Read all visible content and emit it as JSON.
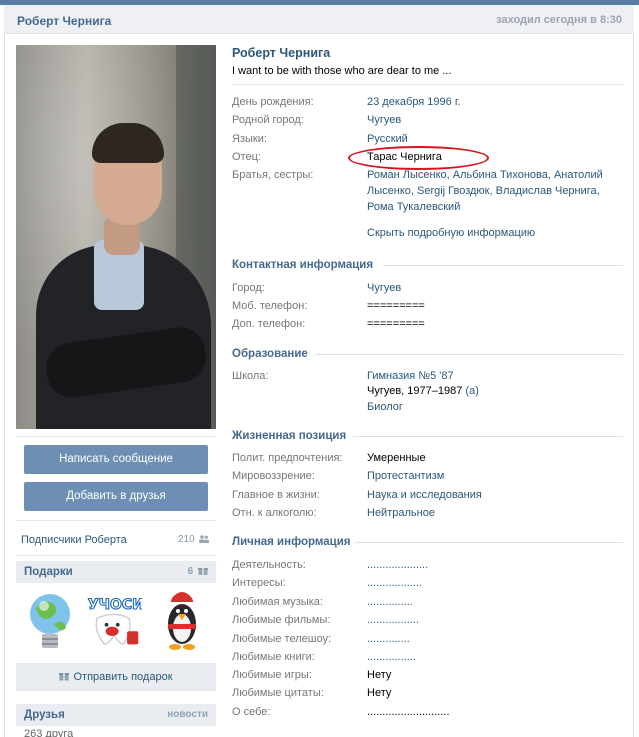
{
  "header": {
    "name": "Роберт Чернига",
    "last_seen": "заходил сегодня в 8:30"
  },
  "left": {
    "write_message": "Написать сообщение",
    "add_friend": "Добавить в друзья",
    "followers_label": "Подписчики Роберта",
    "followers_count": "210",
    "gifts_title": "Подарки",
    "gifts_count": "6",
    "send_gift": "Отправить подарок",
    "friends_title": "Друзья",
    "friends_news": "новости",
    "friends_count": "263 друга"
  },
  "profile": {
    "name": "Роберт Чернига",
    "status": "I want to be with those who are dear to me ...",
    "birthday_label": "День рождения:",
    "birthday": "23 декабря 1996 г.",
    "hometown_label": "Родной город:",
    "hometown": "Чугуев",
    "languages_label": "Языки:",
    "languages": "Русский",
    "father_label": "Отец:",
    "father": "Тарас Чернига",
    "siblings_label": "Братья, сестры:",
    "siblings": [
      "Роман Лысенко, Альбина Тихонова, Анатолий",
      "Лысенко, Sergij Гвоздюк, Владислав Чернига,",
      "Рома Тукалевский"
    ],
    "hide_details": "Скрыть подробную информацию"
  },
  "contacts": {
    "title": "Контактная информация",
    "city_label": "Город:",
    "city": "Чугуев",
    "mobile_label": "Моб. телефон:",
    "mobile": "=========",
    "phone_label": "Доп. телефон:",
    "phone": "========="
  },
  "education": {
    "title": "Образование",
    "school_label": "Школа:",
    "school": "Гимназия №5 '87",
    "years": "Чугуев, 1977–1987",
    "years_link": "(а)",
    "subject": "Биолог"
  },
  "position": {
    "title": "Жизненная позиция",
    "politics_label": "Полит. предпочтения:",
    "politics": "Умеренные",
    "worldview_label": "Мировоззрение:",
    "worldview": "Протестантизм",
    "main_label": "Главное в жизни:",
    "main": "Наука и исследования",
    "alcohol_label": "Отн. к алкоголю:",
    "alcohol": "Нейтральное"
  },
  "personal": {
    "title": "Личная информация",
    "rows": [
      {
        "label": "Деятельность:",
        "value": "...................."
      },
      {
        "label": "Интересы:",
        "value": ".................."
      },
      {
        "label": "Любимая музыка:",
        "value": "..............."
      },
      {
        "label": "Любимые фильмы:",
        "value": "................."
      },
      {
        "label": "Любимые телешоу:",
        "value": ".............."
      },
      {
        "label": "Любимые книги:",
        "value": "................"
      },
      {
        "label": "Любимые игры:",
        "value": "Нету"
      },
      {
        "label": "Любимые цитаты:",
        "value": "Нету"
      },
      {
        "label": "О себе:",
        "value": "..........................."
      }
    ]
  },
  "colors": {
    "link": "#2b587a",
    "accent": "#597da3",
    "button": "#6d8fb3",
    "highlight_ellipse": "#d6141d"
  }
}
